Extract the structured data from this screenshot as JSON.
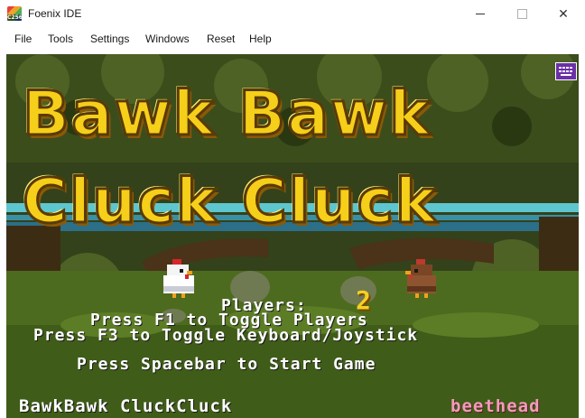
{
  "window": {
    "title": "Foenix IDE",
    "icon_label": "C256",
    "minimize_label": "—",
    "maximize_label": "□",
    "close_label": "✕"
  },
  "menu": {
    "items": [
      "File",
      "Tools",
      "Settings",
      "Windows",
      "Reset",
      "Help"
    ]
  },
  "game": {
    "title_line1": "Bawk Bawk",
    "title_line2": "Cluck Cluck",
    "players_label": "Players:",
    "players_count": "2",
    "toggle_players": "Press F1 to Toggle Players",
    "toggle_input": "Press F3 to Toggle Keyboard/Joystick",
    "start_prompt": "Press Spacebar to Start Game",
    "footer_left": "BawkBawk CluckCluck",
    "footer_right": "beethead"
  },
  "colors": {
    "title_yellow": "#f6cf1a",
    "text_white": "#ffffff",
    "credit_pink": "#f29cb8",
    "keyboard_icon": "#6b2fa8"
  },
  "icons": {
    "keyboard": "keyboard-icon",
    "white_chicken": "white-chicken-sprite",
    "brown_chicken": "brown-chicken-sprite"
  }
}
